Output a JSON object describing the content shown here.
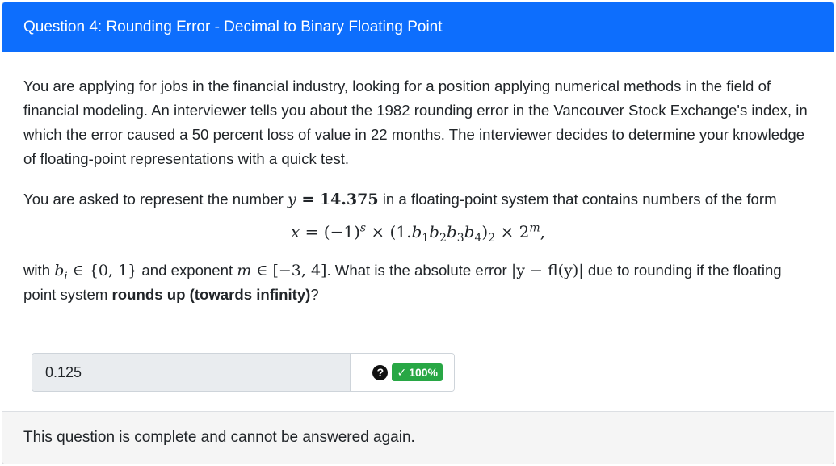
{
  "header": {
    "title": "Question 4: Rounding Error - Decimal to Binary Floating Point"
  },
  "body": {
    "paragraph1": "You are applying for jobs in the financial industry, looking for a position applying numerical methods in the field of financial modeling. An interviewer tells you about the 1982 rounding error in the Vancouver Stock Exchange's index, in which the error caused a 50 percent loss of value in 22 months. The interviewer decides to determine your knowledge of floating-point representations with a quick test.",
    "paragraph2_before": "You are asked to represent the number ",
    "paragraph2_math_var": "y",
    "paragraph2_math_rest": " = 14.375",
    "paragraph2_after": " in a floating-point system that contains numbers of the form",
    "equation": {
      "lhs": "x = (−1)",
      "s": "s",
      "mid": " × (1.b",
      "b1": "1",
      "b2": "2",
      "b3": "3",
      "b4": "4",
      "base": "2",
      "times": " × 2",
      "m": "m",
      "end": ","
    },
    "paragraph3_with": "with ",
    "bi_math": "b",
    "bi_sub": "i",
    "bi_set": " ∈ {0, 1}",
    "paragraph3_exp": " and exponent ",
    "m_math": "m",
    "m_range": " ∈ [−3, 4]",
    "paragraph3_q": ". What is the absolute error ",
    "abs_err_math": "|y − fl(y)|",
    "paragraph3_tail": " due to rounding if the floating point system ",
    "bold_text": "rounds up (towards infinity)",
    "question_mark": "?"
  },
  "answer": {
    "value": "0.125",
    "help_icon": "question-circle-icon",
    "score_label": "100%",
    "check_icon": "check-icon",
    "score_color": "#28a745"
  },
  "footer": {
    "text": "This question is complete and cannot be answered again."
  },
  "colors": {
    "header_bg": "#0d6efd",
    "input_bg": "#e9ecef",
    "footer_bg": "#f5f5f5"
  }
}
